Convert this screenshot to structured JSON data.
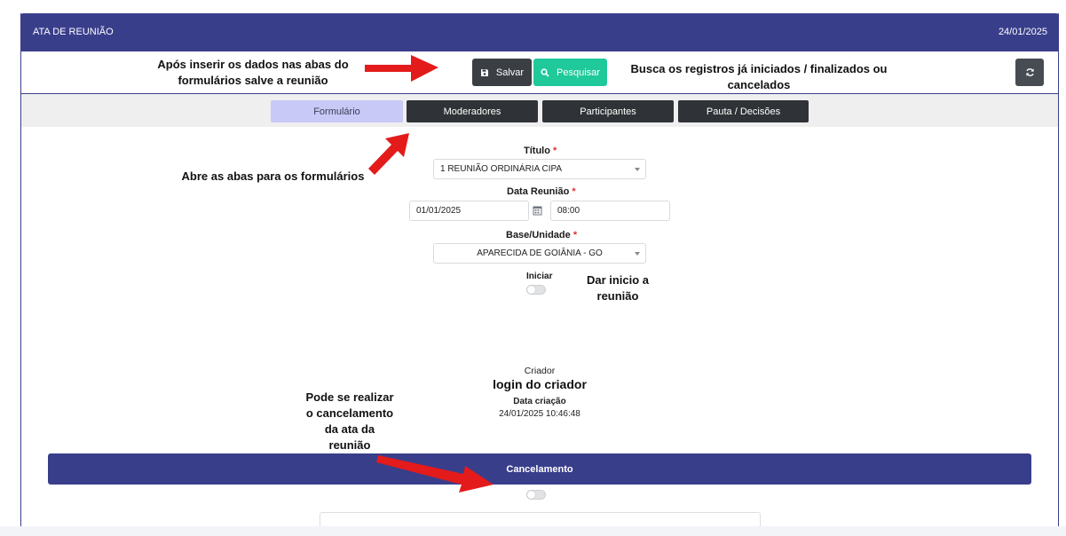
{
  "header": {
    "title": "ATA DE REUNIÃO",
    "date": "24/01/2025"
  },
  "toolbar": {
    "save_label": "Salvar",
    "search_label": "Pesquisar",
    "save_icon": "floppy-disk-icon",
    "search_icon": "search-icon",
    "refresh_icon": "refresh-icon"
  },
  "tabs": [
    {
      "label": "Formulário",
      "active": true
    },
    {
      "label": "Moderadores",
      "active": false
    },
    {
      "label": "Participantes",
      "active": false
    },
    {
      "label": "Pauta / Decisões",
      "active": false
    }
  ],
  "form": {
    "titulo_label": "Título",
    "titulo_value": "1 REUNIÃO ORDINÁRIA CIPA",
    "data_label": "Data Reunião",
    "data_value": "01/01/2025",
    "hora_value": "08:00",
    "base_label": "Base/Unidade",
    "base_value": "APARECIDA DE GOIÂNIA - GO",
    "iniciar_label": "Iniciar",
    "required_mark": "*"
  },
  "meta": {
    "criador_label": "Criador",
    "criador_value": "login do criador",
    "data_criacao_label": "Data criação",
    "data_criacao_value": "24/01/2025 10:46:48"
  },
  "cancel": {
    "label": "Cancelamento"
  },
  "annotations": {
    "save_hint_1": "Após inserir os dados nas abas do",
    "save_hint_2": "formulários salve a reunião",
    "search_hint_1": "Busca os registros já iniciados / finalizados ou",
    "search_hint_2": "cancelados",
    "tabs_hint": "Abre as abas para os formulários",
    "start_hint_1": "Dar inicio a",
    "start_hint_2": "reunião",
    "cancel_hint_1": "Pode se realizar",
    "cancel_hint_2": "o cancelamento",
    "cancel_hint_3": "da ata da",
    "cancel_hint_4": "reunião"
  },
  "colors": {
    "primary": "#393e8b",
    "success": "#1fc99a",
    "dark": "#2f3236",
    "tab_active": "#c8c9f6",
    "arrow": "#e31b1b"
  }
}
